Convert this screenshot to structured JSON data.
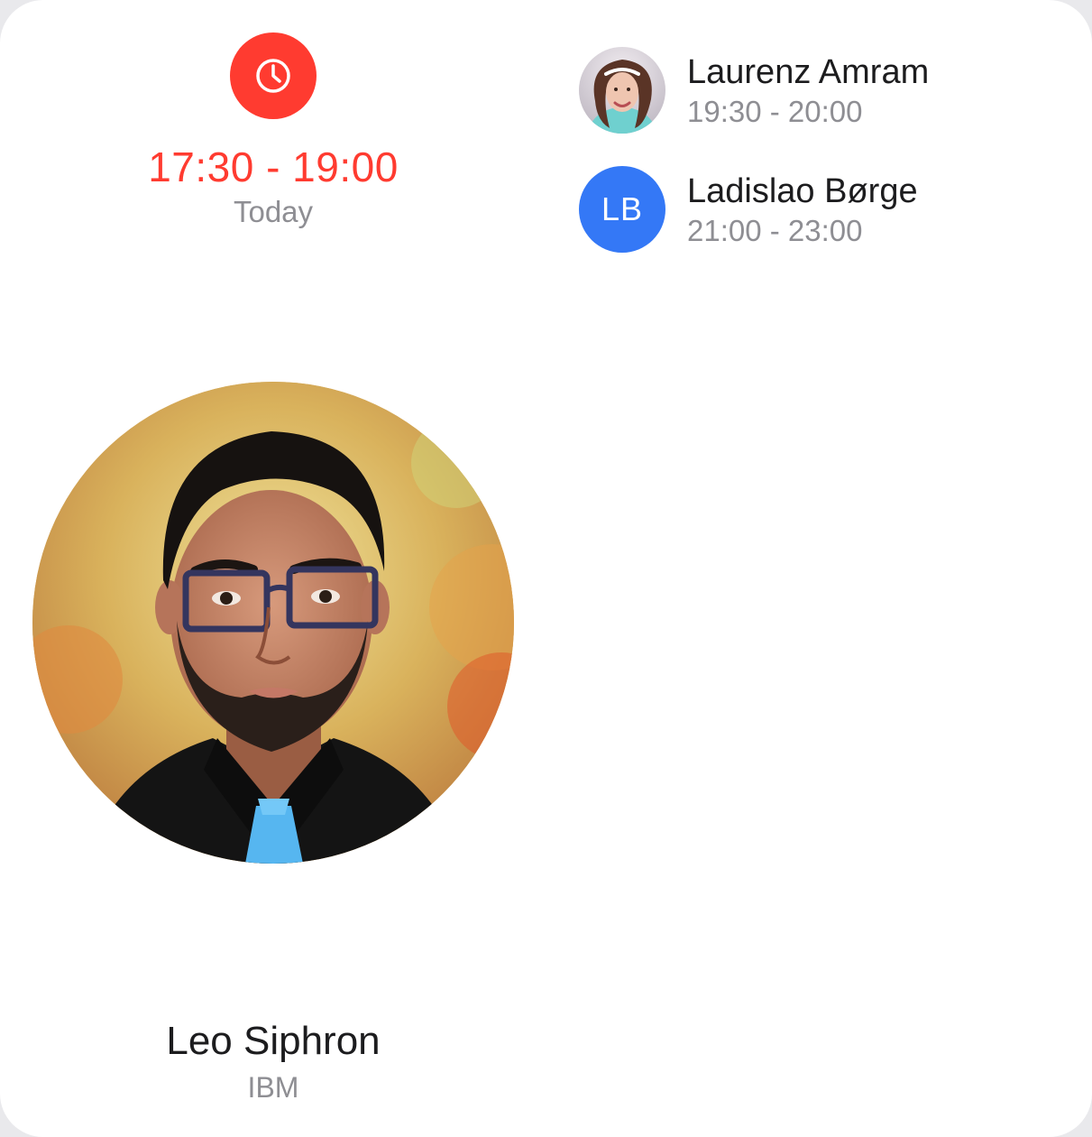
{
  "current_event": {
    "icon": "clock-icon",
    "time_range": "17:30 - 19:00",
    "day": "Today",
    "accent_color": "#ff3b30",
    "host": {
      "name": "Leo Siphron",
      "company": "IBM",
      "photo": "host-portrait-photo"
    }
  },
  "upcoming": [
    {
      "name": "Laurenz Amram",
      "time_range": "19:30 - 20:00",
      "avatar": "photo"
    },
    {
      "name": "Ladislao Børge",
      "time_range": "21:00 - 23:00",
      "avatar": "initials",
      "initials": "LB",
      "avatar_color": "#3478f6"
    }
  ]
}
